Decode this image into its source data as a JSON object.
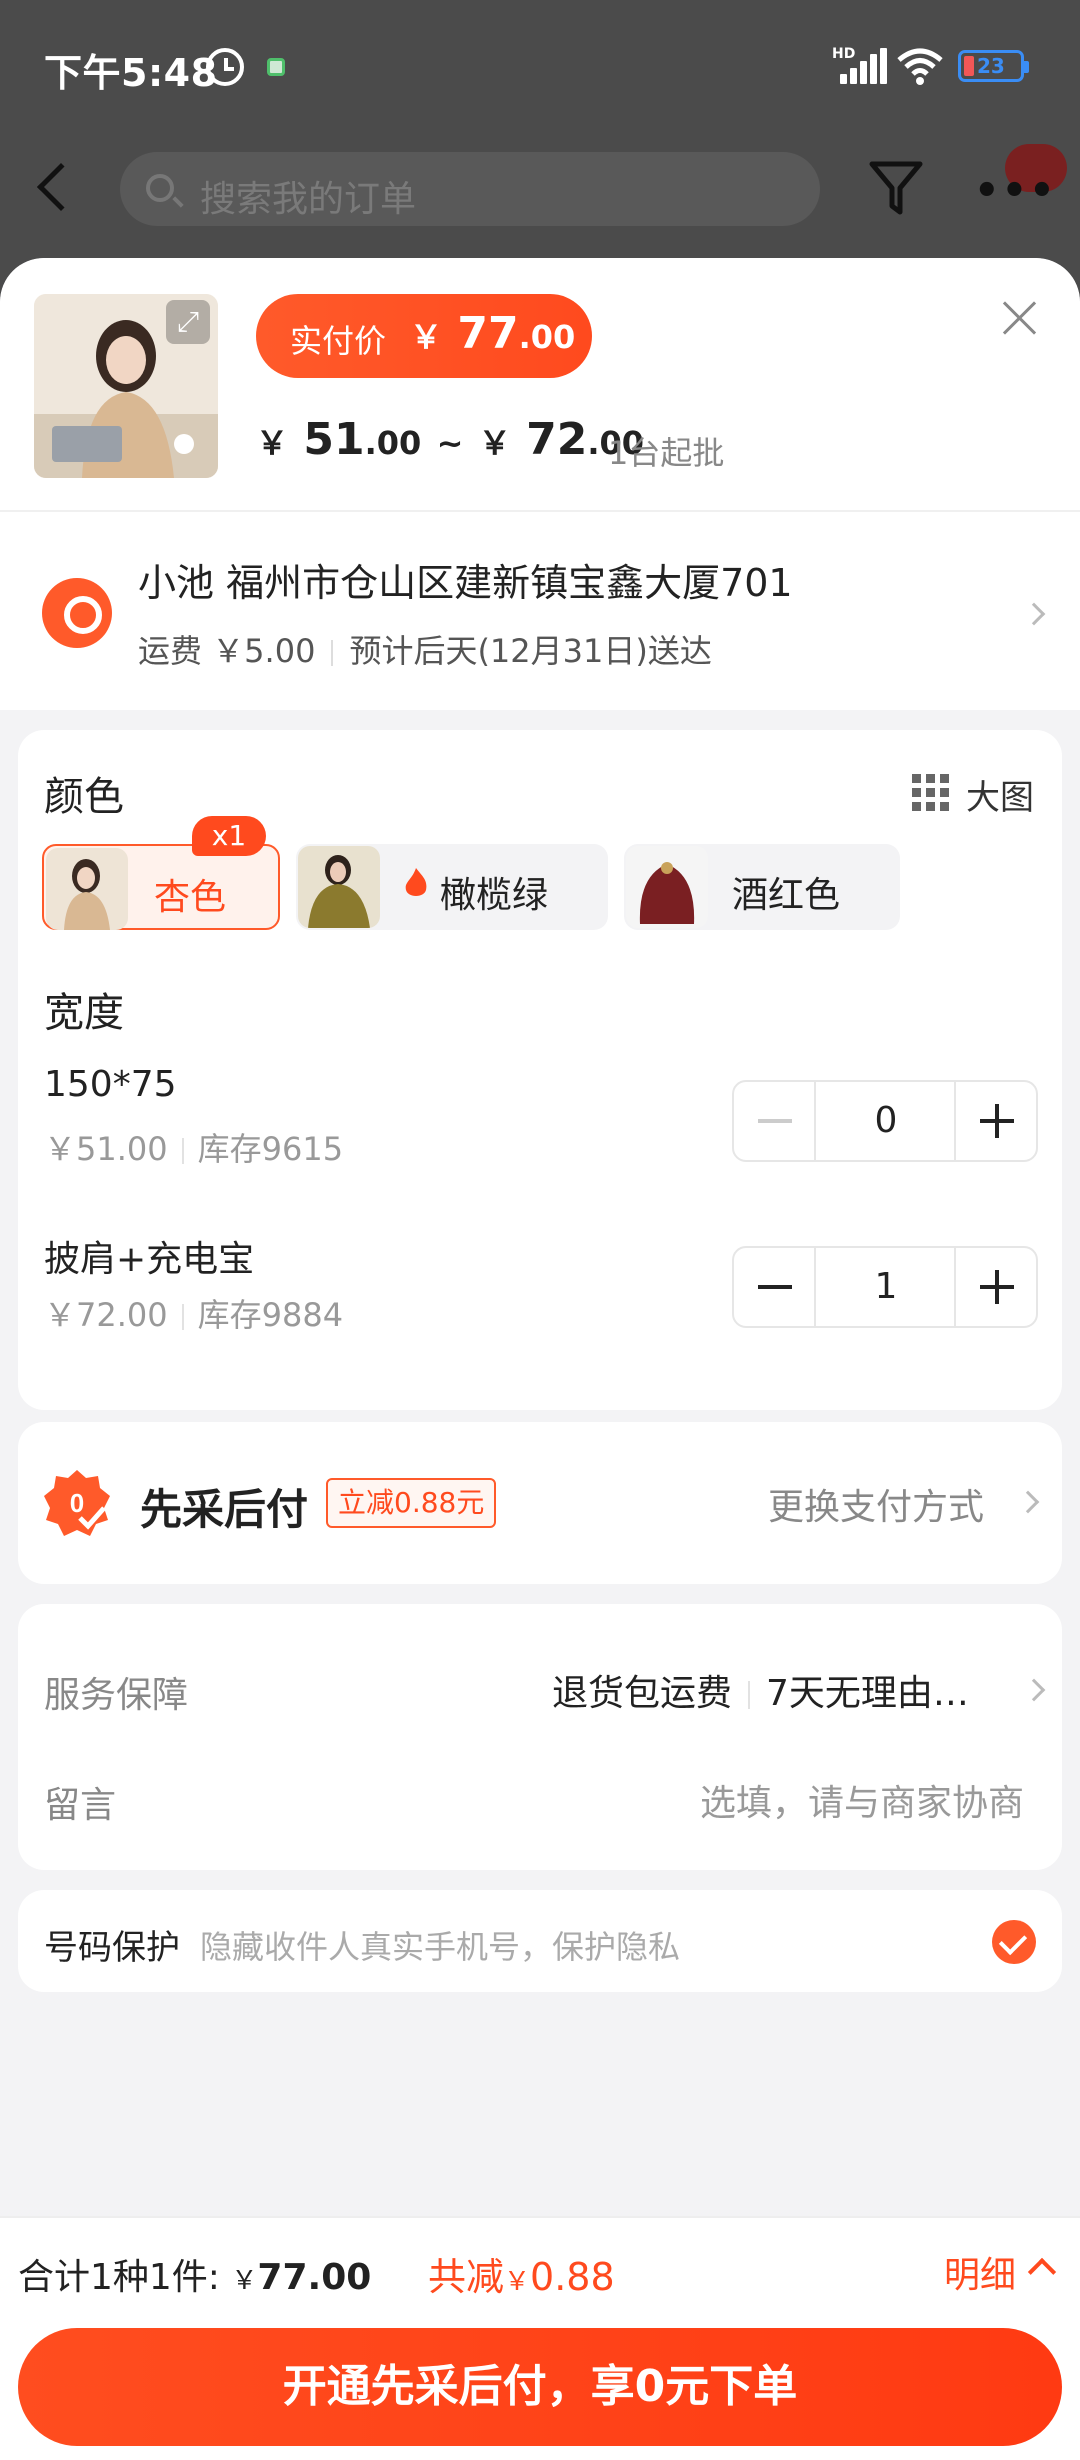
{
  "status_bar": {
    "time": "下午5:48",
    "hd": "HD",
    "battery": "23"
  },
  "top_bar": {
    "search_placeholder": "搜索我的订单"
  },
  "sheet": {
    "paid_label": "实付价",
    "paid_currency": "￥",
    "paid_int": "77",
    "paid_dec": ".00",
    "range_currency": "￥",
    "range_min_int": "51",
    "range_min_dec": ".00",
    "range_sep": "~",
    "range_max_int": "72",
    "range_max_dec": ".00",
    "moq": "1台起批"
  },
  "address": {
    "line": "小池  福州市仓山区建新镇宝鑫大厦701",
    "shipping": "运费 ￥5.00",
    "eta": "预计后天(12月31日)送达"
  },
  "color_section": {
    "title": "颜色",
    "big_view": "大图",
    "options": [
      {
        "label": "杏色",
        "badge": "x1",
        "selected": true
      },
      {
        "label": "橄榄绿",
        "selected": false,
        "fire": true
      },
      {
        "label": "酒红色",
        "selected": false
      }
    ]
  },
  "width_section": {
    "title": "宽度",
    "items": [
      {
        "name": "150*75",
        "price": "￥51.00",
        "stock": "库存9615",
        "qty": "0"
      },
      {
        "name": "披肩+充电宝",
        "price": "￥72.00",
        "stock": "库存9884",
        "qty": "1"
      }
    ]
  },
  "payment": {
    "title": "先采后付",
    "tag": "立减0.88元",
    "change": "更换支付方式"
  },
  "service": {
    "label": "服务保障",
    "value1": "退货包运费",
    "value2": "7天无理由…",
    "message_label": "留言",
    "message_placeholder": "选填，请与商家协商"
  },
  "privacy": {
    "label": "号码保护",
    "hint": "隐藏收件人真实手机号，保护隐私",
    "checked": true
  },
  "footer": {
    "total_label": "合计1种1件:",
    "total_currency": "￥",
    "total_amount": "77.00",
    "save_label": "共减",
    "save_currency": "￥",
    "save_amount": "0.88",
    "detail": "明细",
    "cta": "开通先采后付，享0元下单"
  },
  "colors": {
    "accent": "#ff4a1e",
    "accent_light": "#fff2ec",
    "bg": "#f3f3f5"
  }
}
